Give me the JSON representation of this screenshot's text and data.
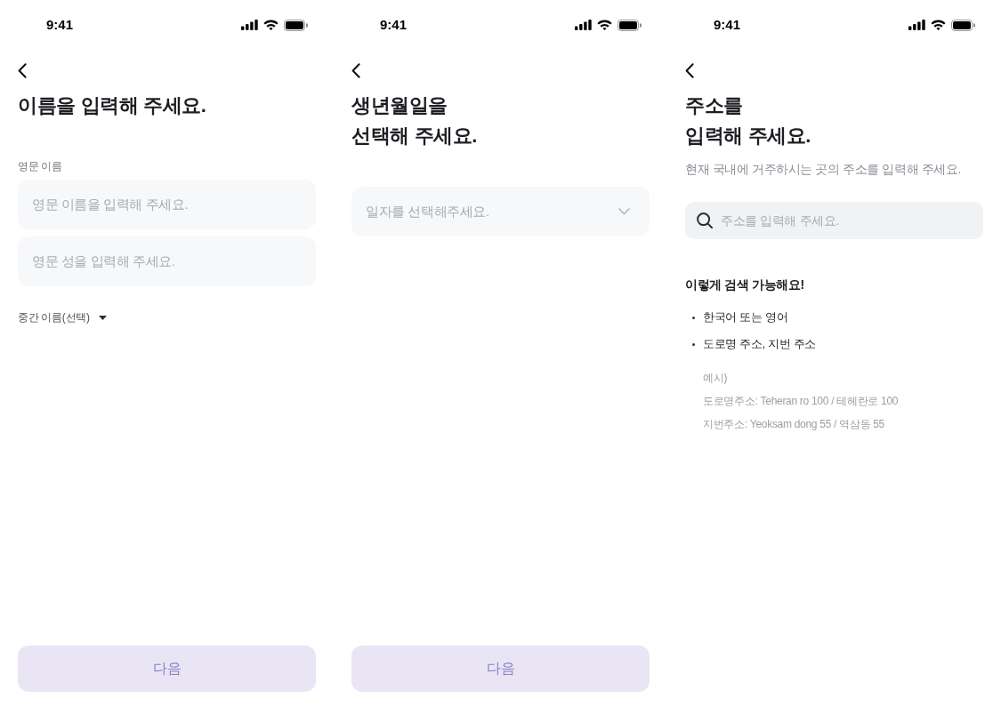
{
  "screens": [
    {
      "kind": "name",
      "status_bar": {
        "time": "9:41"
      },
      "title": "이름을 입력해 주세요.",
      "field_label": "영문 이름",
      "fields": [
        {
          "placeholder": "영문 이름을 입력해 주세요."
        },
        {
          "placeholder": "영문 성을 입력해 주세요."
        }
      ],
      "middle_name_toggle": {
        "label": "중간 이름(선택)",
        "expanded": false
      },
      "next_button": {
        "label": "다음",
        "disabled": true
      }
    },
    {
      "kind": "birthdate",
      "status_bar": {
        "time": "9:41"
      },
      "title": "생년월일을\n선택해 주세요.",
      "date_select": {
        "placeholder": "일자를 선택해주세요."
      },
      "next_button": {
        "label": "다음",
        "disabled": true
      }
    },
    {
      "kind": "address",
      "status_bar": {
        "time": "9:41"
      },
      "title": "주소를\n입력해 주세요.",
      "subtitle": "현재 국내에 거주하시는 곳의 주소를 입력해 주세요.",
      "search": {
        "placeholder": "주소를 입력해 주세요."
      },
      "help": {
        "heading": "이렇게 검색 가능해요!",
        "bullets": [
          "한국어 또는 영어",
          "도로명 주소, 지번 주소"
        ],
        "example_label": "예시)",
        "examples": [
          "도로명주소: Teheran ro 100 / 테헤란로 100",
          "지번주소: Yeoksam dong 55 / 역삼동 55"
        ]
      }
    }
  ]
}
